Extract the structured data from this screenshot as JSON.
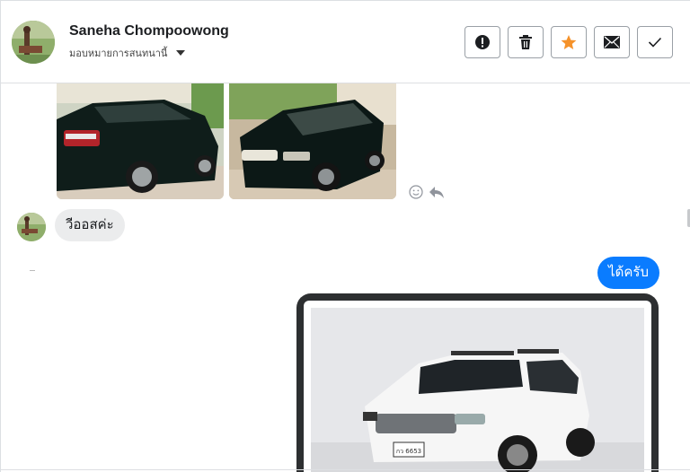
{
  "header": {
    "contact_name": "Saneha Chompoowong",
    "assign_label": "มอบหมายการสนทนานี้",
    "actions": [
      {
        "icon": "alert-icon",
        "label": "Mark as spam"
      },
      {
        "icon": "trash-icon",
        "label": "Delete"
      },
      {
        "icon": "star-icon",
        "label": "Star",
        "active": true,
        "color": "#f5922a"
      },
      {
        "icon": "mail-icon",
        "label": "Mark as unread"
      },
      {
        "icon": "check-icon",
        "label": "Mark as done"
      }
    ]
  },
  "thread": {
    "messages": [
      {
        "from": "contact",
        "type": "images",
        "count": 2
      },
      {
        "from": "contact",
        "type": "text",
        "text": "วีออสค่ะ"
      },
      {
        "from": "page",
        "type": "text",
        "text": "ได้ครับ"
      },
      {
        "from": "page",
        "type": "image"
      }
    ],
    "plate_text": "กว 6653"
  },
  "colors": {
    "outgoing_bubble": "#0a7cff",
    "incoming_bubble": "#ebeced",
    "star": "#f5922a"
  }
}
